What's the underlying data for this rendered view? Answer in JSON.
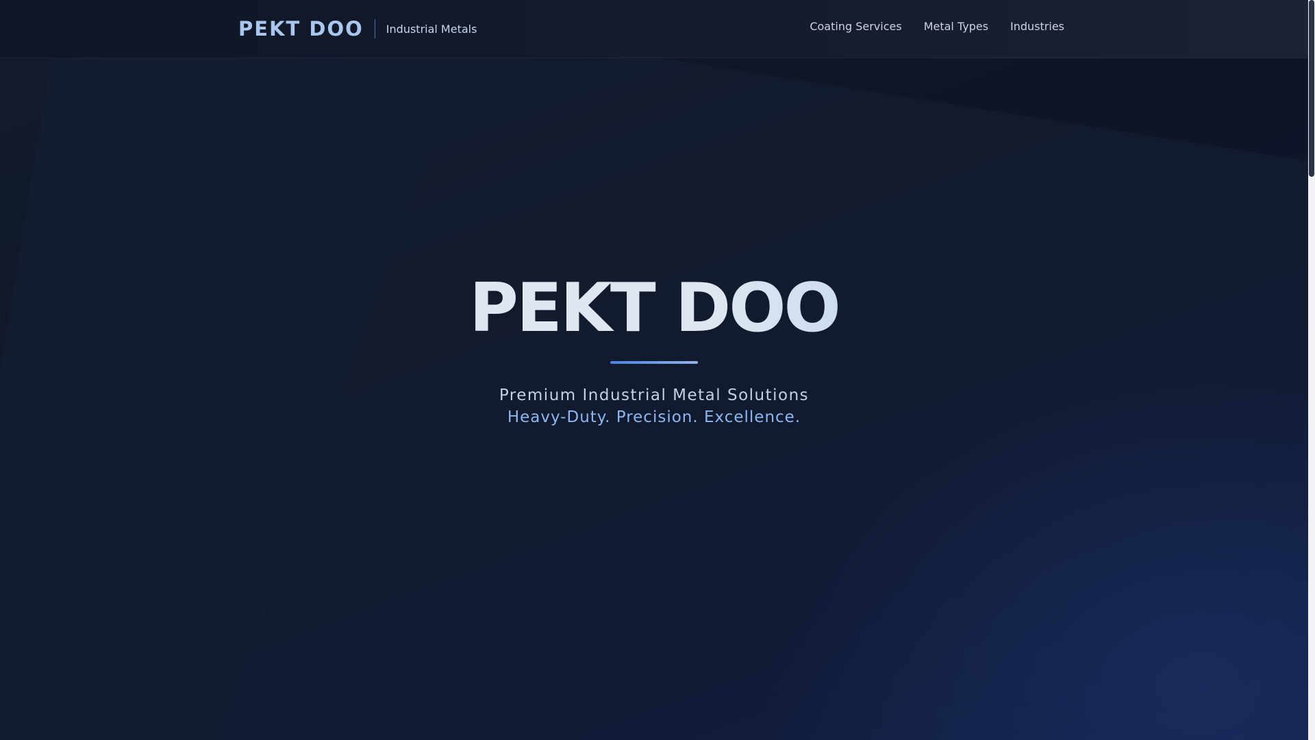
{
  "header": {
    "logo": "PEKT DOO",
    "subtitle": "Industrial Metals",
    "nav": [
      {
        "label": "Coating Services"
      },
      {
        "label": "Metal Types"
      },
      {
        "label": "Industries"
      }
    ]
  },
  "hero": {
    "title": "PEKT DOO",
    "tagline": "Premium Industrial Metal Solutions",
    "motto": "Heavy-Duty. Precision. Excellence."
  },
  "colors": {
    "background": "#121a2c",
    "accent": "#4b82e0",
    "brand_text": "#a9c6ee",
    "motto_text": "#8db7ef"
  }
}
